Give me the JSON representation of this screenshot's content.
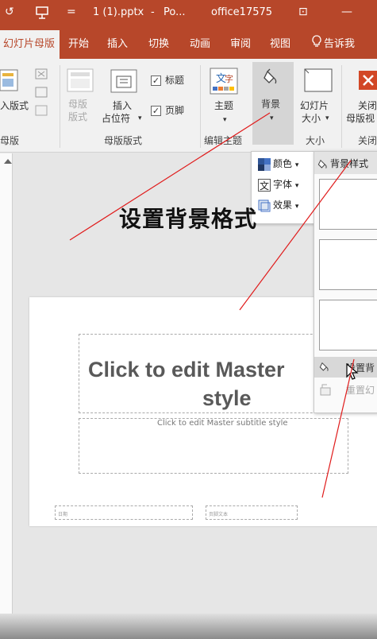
{
  "titlebar": {
    "filename": "1 (1).pptx",
    "separator": "-",
    "app_short": "Po...",
    "account": "office17575",
    "undo_glyph": "↺",
    "customize_glyph": "=",
    "restore_glyph": "⊡",
    "minimize_glyph": "—"
  },
  "tabs": {
    "master": "幻灯片母版",
    "home": "开始",
    "insert": "插入",
    "transitions": "切换",
    "animations": "动画",
    "review": "审阅",
    "view": "视图",
    "tell_me": "告诉我"
  },
  "ribbon": {
    "insert_layout": "入版式",
    "edit_master_group": "母版",
    "master_layout_btn_line1": "母版",
    "master_layout_btn_line2": "版式",
    "insert_placeholder_line1": "插入",
    "insert_placeholder_line2": "占位符",
    "title_checkbox": "标题",
    "footer_checkbox": "页脚",
    "master_layout_group": "母版版式",
    "themes_btn": "主题",
    "edit_theme_group": "编辑主题",
    "background_btn": "背景",
    "slide_size_line1": "幻灯片",
    "slide_size_line2": "大小",
    "size_group": "大小",
    "close_line1": "关闭",
    "close_line2": "母版视",
    "close_group": "关闭",
    "dropdown_arrow": "▾",
    "checkmark": "✓"
  },
  "background_menu": {
    "colors": "颜色",
    "fonts": "字体",
    "effects": "效果",
    "arrow": "▾"
  },
  "gallery": {
    "header": "背景样式",
    "format_background": "设置背",
    "reset": "重置幻"
  },
  "caption": "设置背景格式",
  "slide": {
    "title_line1": "Click to edit Master",
    "title_line2": "style",
    "subtitle": "Click to edit Master subtitle style",
    "date_text": "日期",
    "footer_text": "页脚文本"
  },
  "colors": {
    "accent": "#b7472a",
    "ribbon_bg": "#f1f1f1",
    "annotation_red": "#e01b1b"
  }
}
